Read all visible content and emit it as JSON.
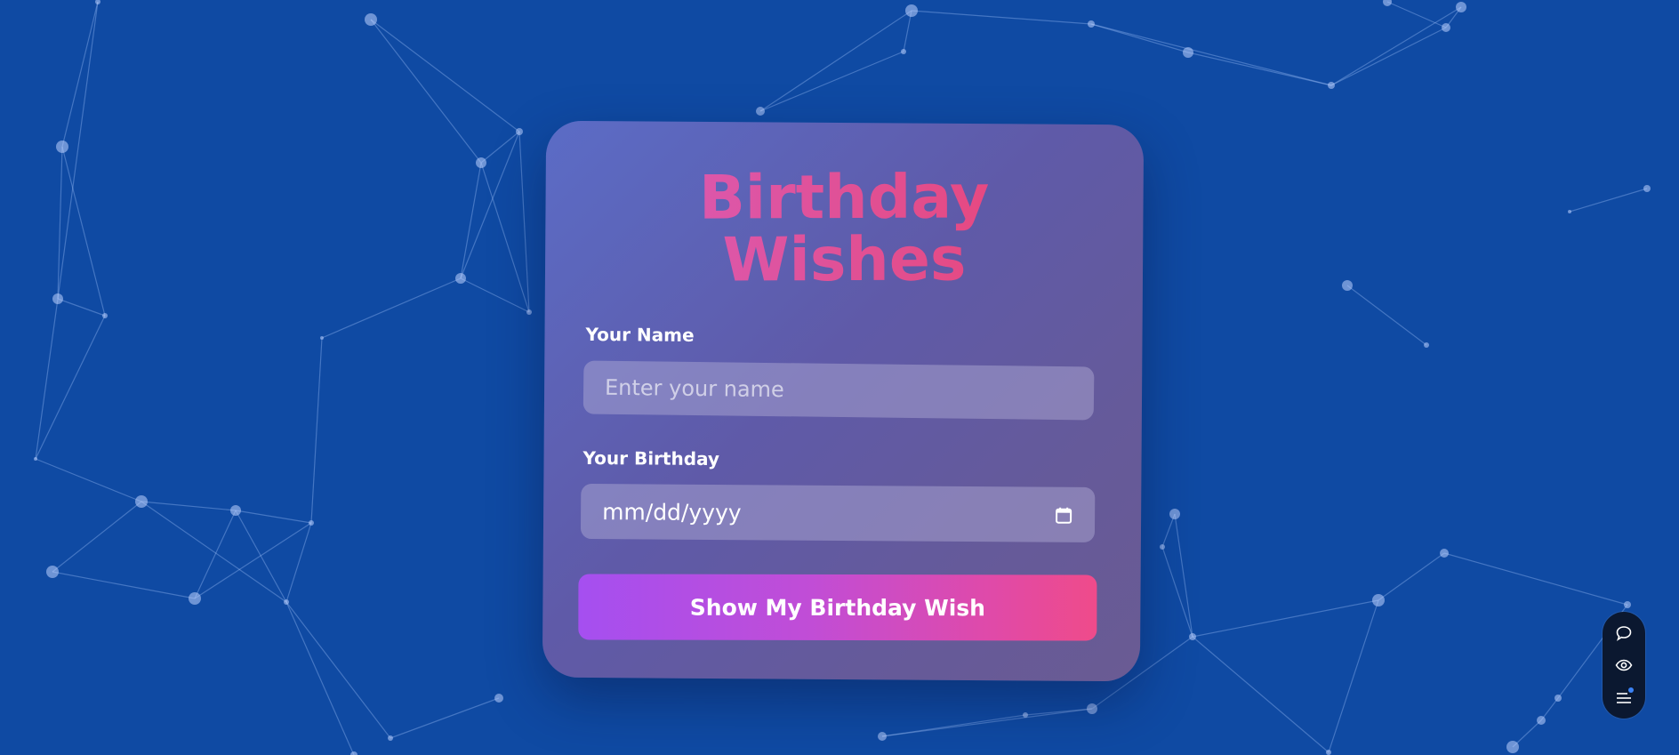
{
  "page": {
    "title_line1": "Birthday",
    "title_line2": "Wishes"
  },
  "form": {
    "name_label": "Your Name",
    "name_placeholder": "Enter your name",
    "name_value": "",
    "birthday_label": "Your Birthday",
    "birthday_placeholder": "mm/dd/yyyy",
    "submit_label": "Show My Birthday Wish"
  },
  "dock": {
    "icons": [
      "chat-icon",
      "eye-icon",
      "menu-icon"
    ]
  },
  "colors": {
    "background": "#0f4aa3",
    "title_gradient_start": "#d85ec0",
    "title_gradient_end": "#ee3f6a",
    "button_gradient_start": "#a54ff0",
    "button_gradient_end": "#ef4b8a",
    "dock_background": "#0b1830",
    "notification_dot": "#3b82f6"
  }
}
